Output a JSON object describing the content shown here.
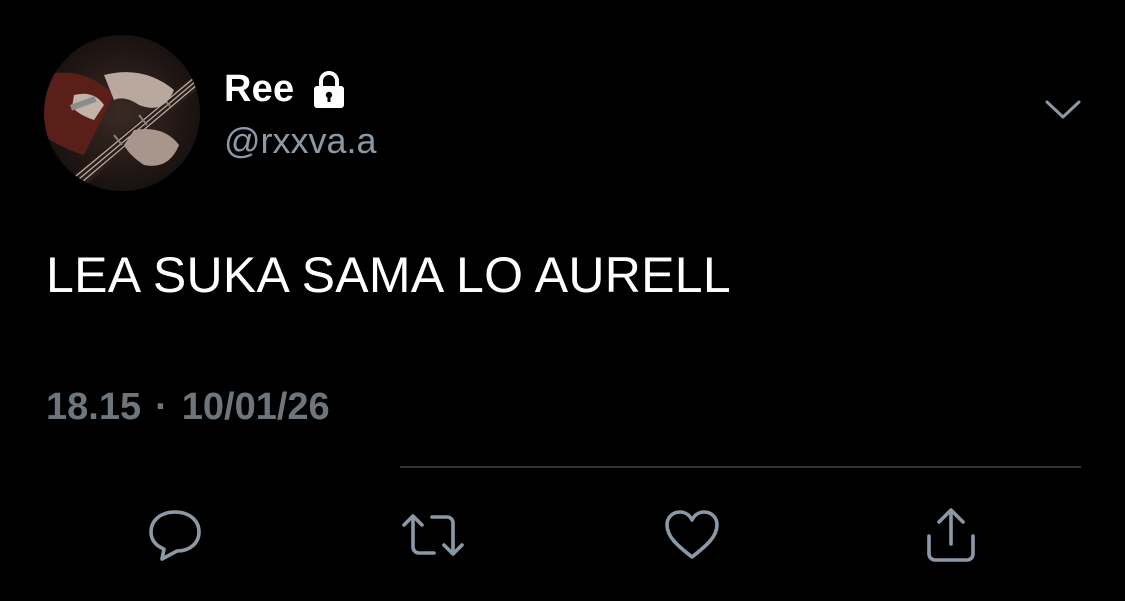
{
  "tweet": {
    "display_name": "Ree",
    "handle": "@rxxva.a",
    "protected_icon": "lock-icon",
    "text": "LEA SUKA SAMA LO AURELL",
    "time": "18.15",
    "separator": "·",
    "date": "10/01/26",
    "menu_icon": "chevron-down-icon"
  },
  "actions": [
    {
      "icon": "reply-icon"
    },
    {
      "icon": "retweet-icon"
    },
    {
      "icon": "like-icon"
    },
    {
      "icon": "share-icon"
    }
  ],
  "colors": {
    "background": "#000000",
    "primary_text": "#ffffff",
    "secondary_text": "#8b98a5",
    "muted_text": "#6e767d",
    "icon": "#8b98a5",
    "divider": "#2f3336"
  }
}
